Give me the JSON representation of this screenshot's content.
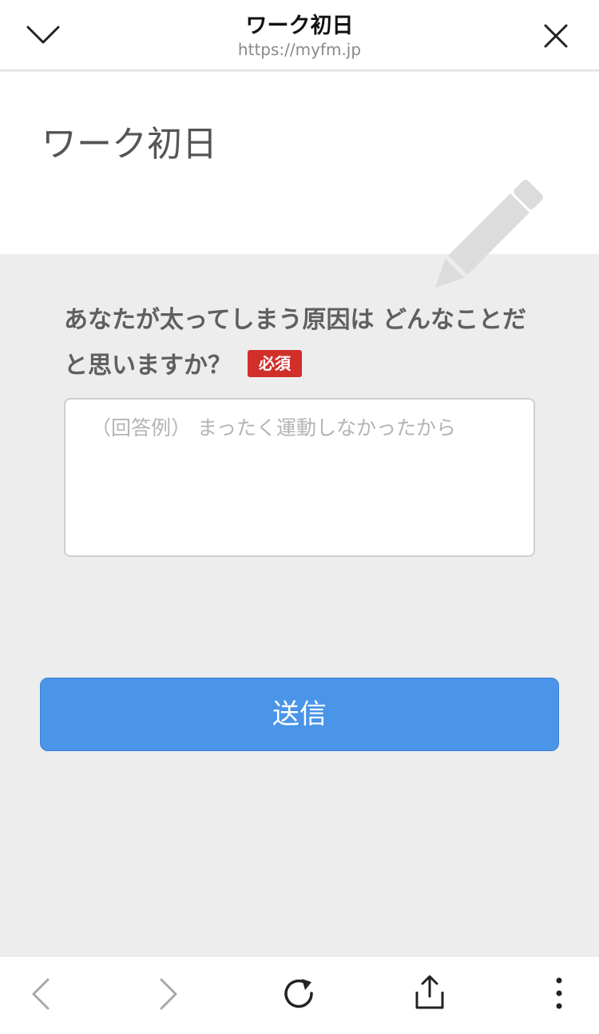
{
  "browser": {
    "title": "ワーク初日",
    "url": "https://myfm.jp",
    "icons": {
      "collapse": "chevron-down-icon",
      "close": "close-icon",
      "back": "chevron-left-icon",
      "forward": "chevron-right-icon",
      "reload": "reload-icon",
      "share": "share-icon",
      "more": "more-vertical-icon"
    }
  },
  "header": {
    "title": "ワーク初日",
    "icon": "pencil-icon"
  },
  "form": {
    "question": "あなたが太ってしまう原因は どんなことだと思いますか？",
    "required_label": "必須",
    "answer_placeholder": "（回答例） まったく運動しなかったから",
    "answer_value": "",
    "submit_label": "送信"
  },
  "colors": {
    "accent": "#4a95e8",
    "required_badge": "#d12f2a",
    "background": "#ededed"
  }
}
